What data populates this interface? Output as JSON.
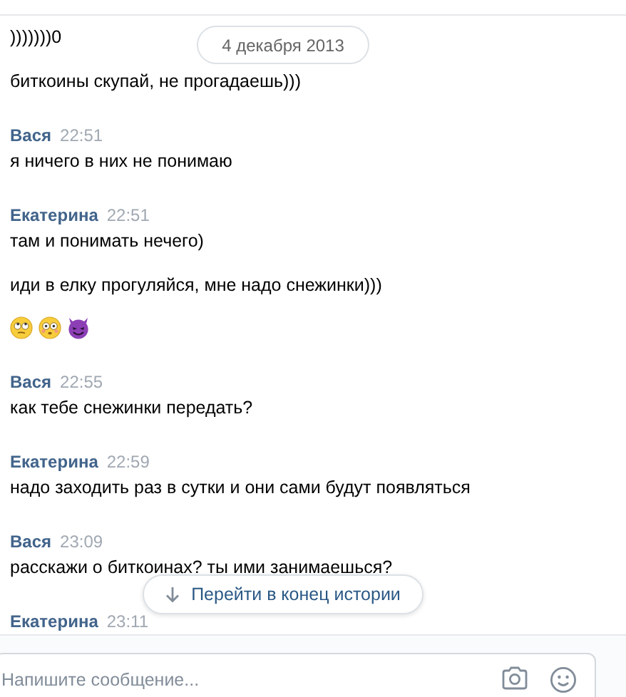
{
  "date_pill": "4 декабря 2013",
  "messages": [
    {
      "kind": "text",
      "text": ")))))))0"
    },
    {
      "kind": "text",
      "text": "биткоины скупай, не прогадаешь)))"
    },
    {
      "kind": "author",
      "name": "Вася",
      "time": "22:51"
    },
    {
      "kind": "text",
      "text": "я ничего в них не понимаю"
    },
    {
      "kind": "author",
      "name": "Екатерина",
      "time": "22:51"
    },
    {
      "kind": "text",
      "text": "там и понимать нечего)"
    },
    {
      "kind": "text",
      "text": "иди в елку прогуляйся, мне надо снежинки)))"
    },
    {
      "kind": "emoji"
    },
    {
      "kind": "author",
      "name": "Вася",
      "time": "22:55"
    },
    {
      "kind": "text",
      "text": "как тебе снежинки передать?"
    },
    {
      "kind": "author",
      "name": "Екатерина",
      "time": "22:59"
    },
    {
      "kind": "text",
      "text": "надо заходить раз в сутки и они сами будут появляться"
    },
    {
      "kind": "author",
      "name": "Вася",
      "time": "23:09"
    },
    {
      "kind": "text",
      "text": "расскажи о биткоинах? ты ими занимаешься?"
    },
    {
      "kind": "author",
      "name": "Екатерина",
      "time": "23:11"
    }
  ],
  "jump_button": {
    "label": "Перейти в конец истории"
  },
  "composer": {
    "placeholder": "Напишите сообщение..."
  }
}
